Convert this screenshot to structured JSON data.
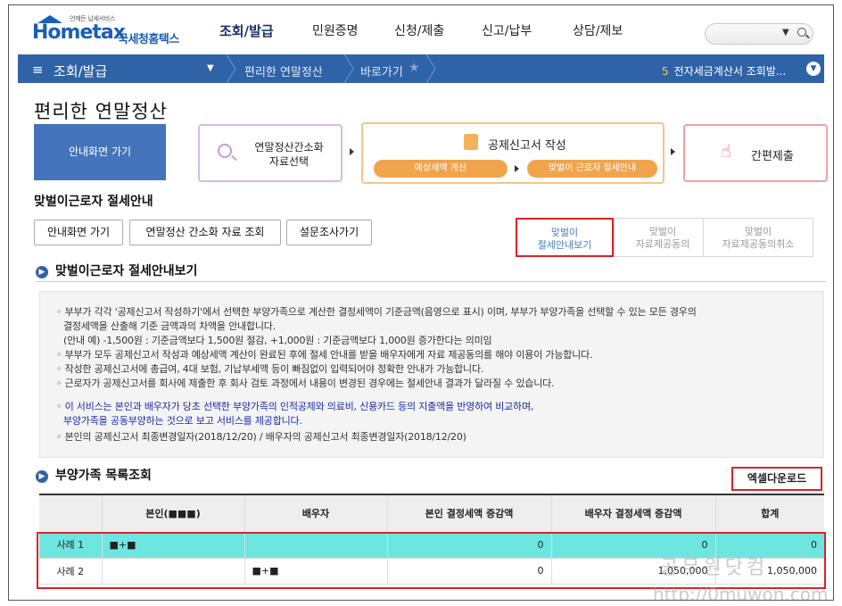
{
  "logo": {
    "tagline": "언제든 납세서비스",
    "brand_en": "Hometax",
    "brand_kr": "국세청홈택스"
  },
  "nav": {
    "items": [
      "조회/발급",
      "민원증명",
      "신청/제출",
      "신고/납부",
      "상담/제보"
    ]
  },
  "bluebar": {
    "section": "조회/발급",
    "crumb1": "편리한 연말정산",
    "crumb2": "바로가기",
    "notice_num": "5",
    "notice_text": "전자세금계산서 조회발..."
  },
  "page_title": "편리한 연말정산",
  "steps": {
    "guide": "안내화면 가기",
    "step1_line1": "연말정산간소화",
    "step1_line2": "자료선택",
    "step2_title": "공제신고서 작성",
    "step2_pill1": "예상세액 계산",
    "step2_pill2": "맞벌이 근로자 절세안내",
    "step3": "간편제출"
  },
  "subtitle": "맞벌이근로자 절세안내",
  "buttons": {
    "guide": "안내화면 가기",
    "simple": "연말정산 간소화 자료 조회",
    "survey": "설문조사가기"
  },
  "tabs": [
    {
      "line1": "맞벌이",
      "line2": "절세안내보기"
    },
    {
      "line1": "맞벌이",
      "line2": "자료제공동의"
    },
    {
      "line1": "맞벌이",
      "line2": "자료제공동의취소"
    }
  ],
  "section1": "맞벌이근로자 절세안내보기",
  "info": [
    "◦ 부부가 각각 '공제신고서 작성하기'에서 선택한 부양가족으로 계산한 결정세액이 기준금액(음영으로 표시) 이며, 부부가 부양가족을 선택할 수 있는 모든 경우의",
    "결정세액을 산출해 기준 금액과의 차액을 안내합니다.",
    "(안내 예) -1,500원 : 기준금액보다 1,500원 절감, +1,000원 : 기준금액보다 1,000원 증가한다는 의미임",
    "◦ 부부가 모두 공제신고서 작성과 예상세액 계산이 완료된 후에 절세 안내를 받을 배우자에게 자료 제공동의를 해야 이용이 가능합니다.",
    "◦ 작성한 공제신고서에 총급여, 4대 보험, 기납부세액 등이 빠짐없이 입력되어야 정확한 안내가 가능합니다.",
    "◦ 근로자가 공제신고서를 회사에 제출한 후 회사 검토 과정에서 내용이 변경된 경우에는 절세안내 결과가 달라질 수 있습니다."
  ],
  "info_blue": [
    "◦ 이 서비스는 본인과 배우자가 당초 선택한 부양가족의 인적공제와 의료비, 신용카드 등의 지출액을 반영하여 비교하며,",
    "부양가족을 공동부양하는 것으로 보고 서비스를 제공합니다."
  ],
  "info_last": "◦ 본인의 공제신고서 최종변경일자(2018/12/20) / 배우자의 공제신고서 최종변경일자(2018/12/20)",
  "section2": "부양가족 목록조회",
  "excel_button": "엑셀다운로드",
  "table": {
    "headers": [
      "",
      "본인(■■■)",
      "배우자",
      "본인 결정세액 증감액",
      "배우자 결정세액 증감액",
      "합계"
    ],
    "rows": [
      {
        "case": "사례 1",
        "self": "■+■",
        "spouse": "",
        "self_tax": "0",
        "spouse_tax": "0",
        "total": "0"
      },
      {
        "case": "사례 2",
        "self": "",
        "spouse": "■+■",
        "self_tax": "0",
        "spouse_tax": "1,050,000",
        "total": "1,050,000"
      }
    ]
  },
  "watermark": {
    "line1": "공무원닷컴",
    "line2": "http://0muwon.com"
  },
  "colors": {
    "accent": "#2f63a8",
    "highlight": "#6ee6e0",
    "frame_red": "#d9232a"
  }
}
